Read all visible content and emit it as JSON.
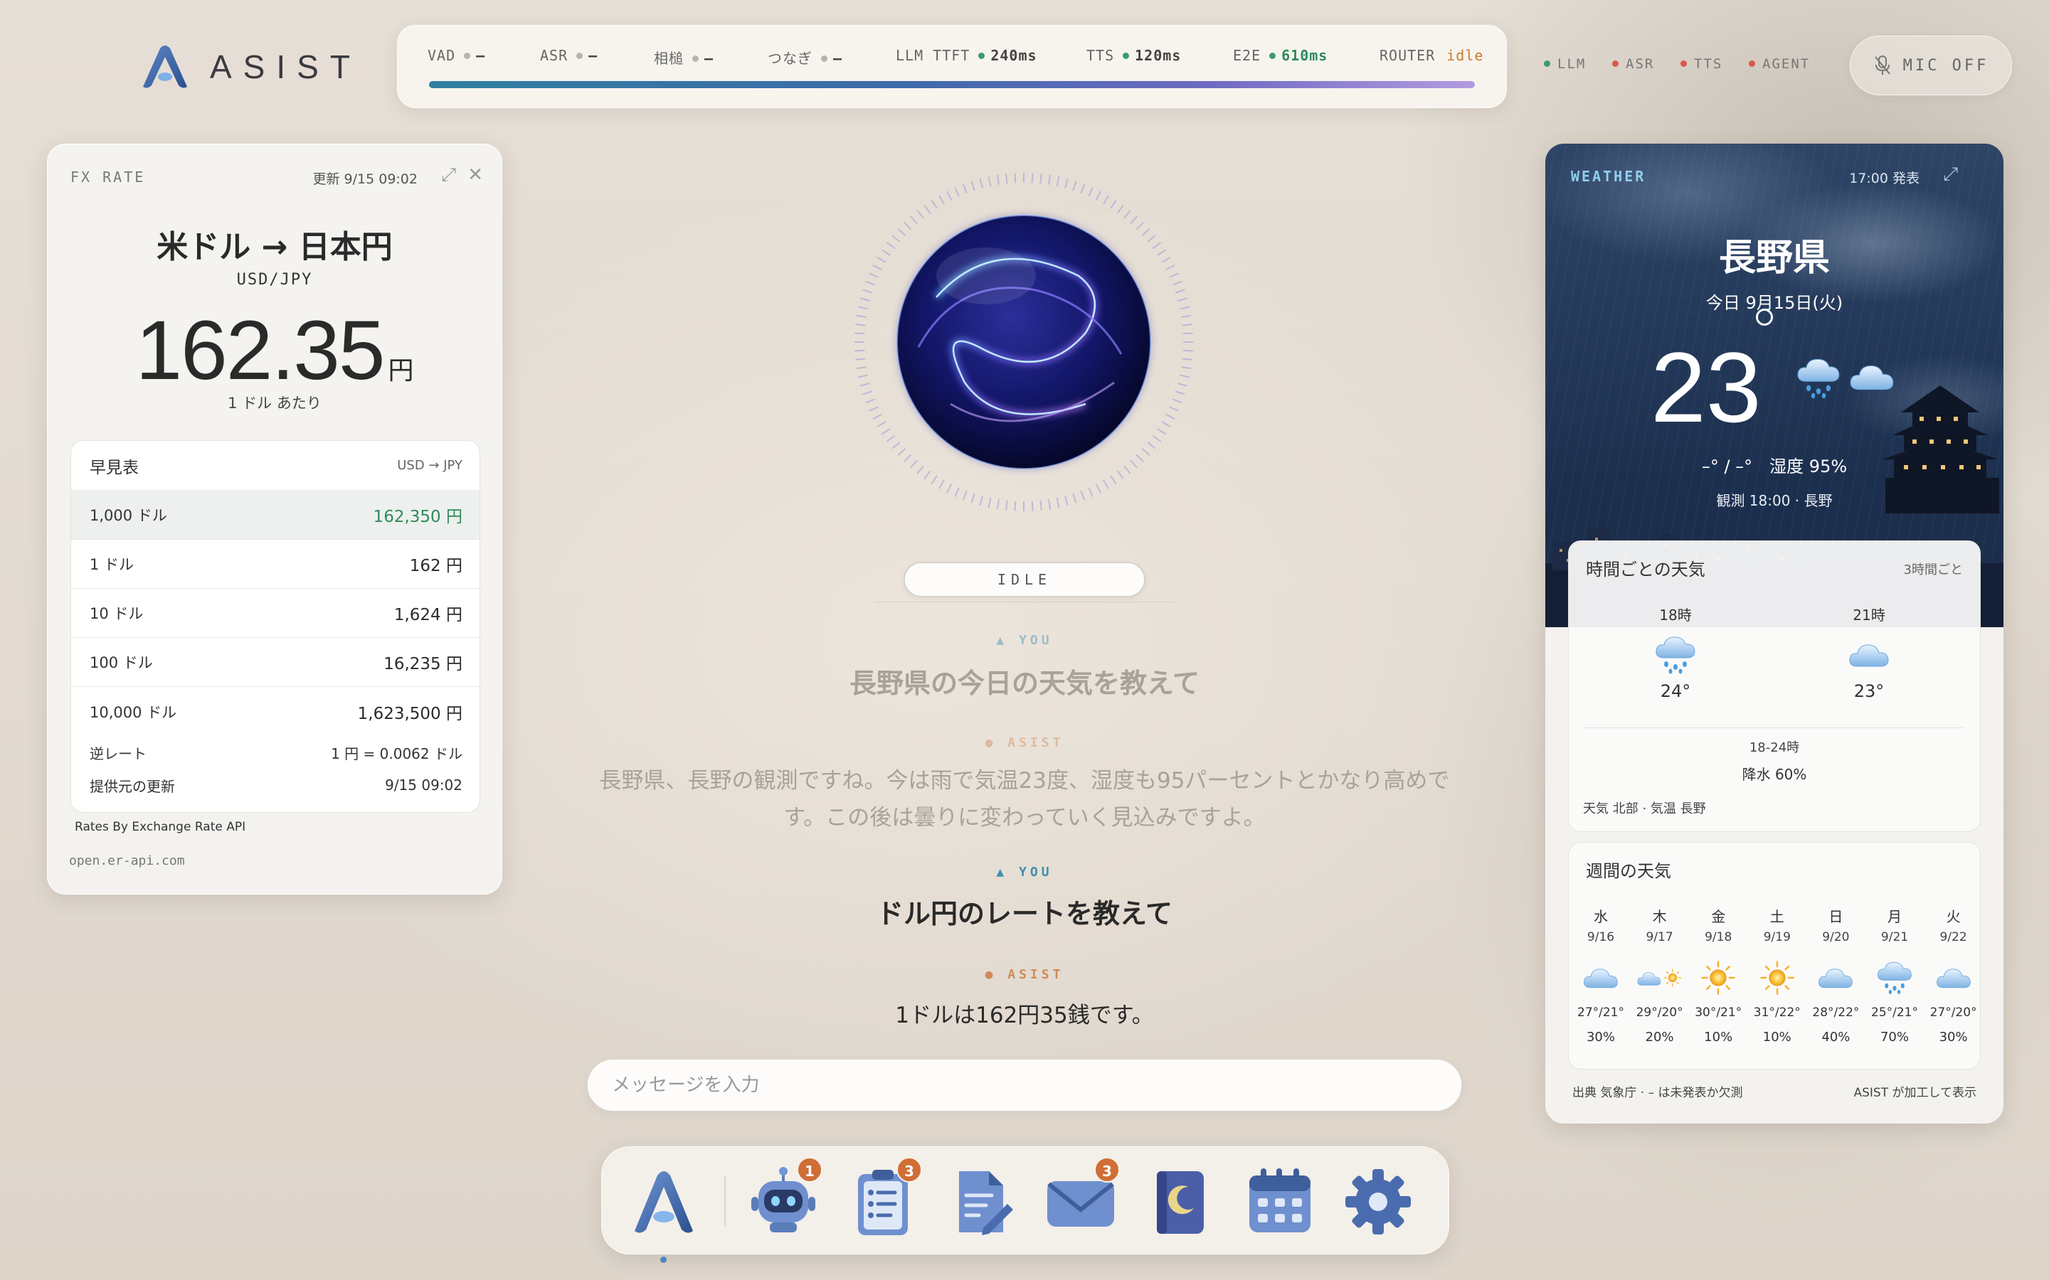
{
  "app": {
    "name": "ASIST"
  },
  "metrics": [
    {
      "label": "VAD",
      "value": "–",
      "state": "off"
    },
    {
      "label": "ASR",
      "value": "–",
      "state": "off"
    },
    {
      "label": "相槌",
      "value": "–",
      "state": "off"
    },
    {
      "label": "つなぎ",
      "value": "–",
      "state": "off"
    },
    {
      "label": "LLM TTFT",
      "value": "240ms",
      "state": "on"
    },
    {
      "label": "TTS",
      "value": "120ms",
      "state": "on"
    },
    {
      "label": "E2E",
      "value": "610ms",
      "state": "on"
    },
    {
      "label": "ROUTER",
      "value": "idle",
      "state": "none"
    }
  ],
  "services": [
    {
      "label": "LLM",
      "color": "#3c9a6b"
    },
    {
      "label": "ASR",
      "color": "#d9584a"
    },
    {
      "label": "TTS",
      "color": "#d9584a"
    },
    {
      "label": "AGENT",
      "color": "#d9584a"
    }
  ],
  "mic": {
    "label": "MIC OFF",
    "icon": "mic-off-icon"
  },
  "fx": {
    "tag": "FX RATE",
    "updated": "更新 9/15 09:02",
    "title": "米ドル → 日本円",
    "pair": "USD/JPY",
    "rate": "162.35",
    "unit": "円",
    "per": "1 ドル あたり",
    "table": {
      "title": "早見表",
      "subtitle": "USD → JPY",
      "rows": [
        {
          "label": "1,000 ドル",
          "value": "162,350 円",
          "highlight": true
        },
        {
          "label": "1 ドル",
          "value": "162 円"
        },
        {
          "label": "10 ドル",
          "value": "1,624 円"
        },
        {
          "label": "100 ドル",
          "value": "16,235 円"
        },
        {
          "label": "10,000 ドル",
          "value": "1,623,500 円"
        }
      ],
      "inverse_label": "逆レート",
      "inverse_value": "1 円 = 0.0062 ドル",
      "provider_label": "提供元の更新",
      "provider_value": "9/15 09:02"
    },
    "credit": "Rates By Exchange Rate API",
    "url": "open.er-api.com"
  },
  "assistant": {
    "state": "IDLE",
    "conversation": [
      {
        "role": "YOU",
        "text": "長野県の今日の天気を教えて",
        "faded": true
      },
      {
        "role": "ASIST",
        "text_line1": "長野県、長野の観測ですね。今は雨で気温23度、湿度も95パーセントとかなり高めで",
        "text_line2": "す。この後は曇りに変わっていく見込みですよ。",
        "faded": true
      },
      {
        "role": "YOU",
        "text": "ドル円のレートを教えて",
        "faded": false
      },
      {
        "role": "ASIST",
        "text": "1ドルは162円35銭です。",
        "faded": false
      }
    ],
    "input_placeholder": "メッセージを入力"
  },
  "dock": [
    {
      "name": "asist-home",
      "icon": "asist-logo-icon",
      "badge": "",
      "active": true
    },
    {
      "name": "agent",
      "icon": "robot-icon",
      "badge": "1"
    },
    {
      "name": "tasks",
      "icon": "clipboard-list-icon",
      "badge": "3"
    },
    {
      "name": "notes",
      "icon": "document-edit-icon",
      "badge": ""
    },
    {
      "name": "mail",
      "icon": "envelope-icon",
      "badge": "3"
    },
    {
      "name": "journal",
      "icon": "moon-book-icon",
      "badge": ""
    },
    {
      "name": "calendar",
      "icon": "calendar-icon",
      "badge": ""
    },
    {
      "name": "settings",
      "icon": "gear-icon",
      "badge": ""
    }
  ],
  "weather": {
    "tag": "WEATHER",
    "issued": "17:00 発表",
    "prefecture": "長野県",
    "date": "今日 9月15日(火)",
    "temp": "23",
    "hi_lo": "–° / –°",
    "humidity": "湿度 95%",
    "observed": "観測 18:00 · 長野",
    "hourly": {
      "title": "時間ごとの天気",
      "interval": "3時間ごと",
      "slots": [
        {
          "time": "18時",
          "icon": "rain-cloud-icon",
          "temp": "24°"
        },
        {
          "time": "21時",
          "icon": "cloud-icon",
          "temp": "23°"
        }
      ],
      "range": "18-24時",
      "pop": "降水 60%",
      "source": "天気 北部 · 気温 長野"
    },
    "weekly": {
      "title": "週間の天気",
      "days": [
        {
          "day": "水",
          "date": "9/16",
          "icon": "cloud-icon",
          "temp": "27°/21°",
          "pop": "30%"
        },
        {
          "day": "木",
          "date": "9/17",
          "icon": "cloud-sun-icon",
          "temp": "29°/20°",
          "pop": "20%"
        },
        {
          "day": "金",
          "date": "9/18",
          "icon": "sun-icon",
          "temp": "30°/21°",
          "pop": "10%"
        },
        {
          "day": "土",
          "date": "9/19",
          "icon": "sun-icon",
          "temp": "31°/22°",
          "pop": "10%"
        },
        {
          "day": "日",
          "date": "9/20",
          "icon": "cloud-icon",
          "temp": "28°/22°",
          "pop": "40%"
        },
        {
          "day": "月",
          "date": "9/21",
          "icon": "rain-cloud-icon",
          "temp": "25°/21°",
          "pop": "70%"
        },
        {
          "day": "火",
          "date": "9/22",
          "icon": "cloud-icon",
          "temp": "27°/20°",
          "pop": "30%"
        }
      ]
    },
    "footer_left": "出典 気象庁 · – は未発表か欠測",
    "footer_right": "ASIST が加工して表示"
  }
}
